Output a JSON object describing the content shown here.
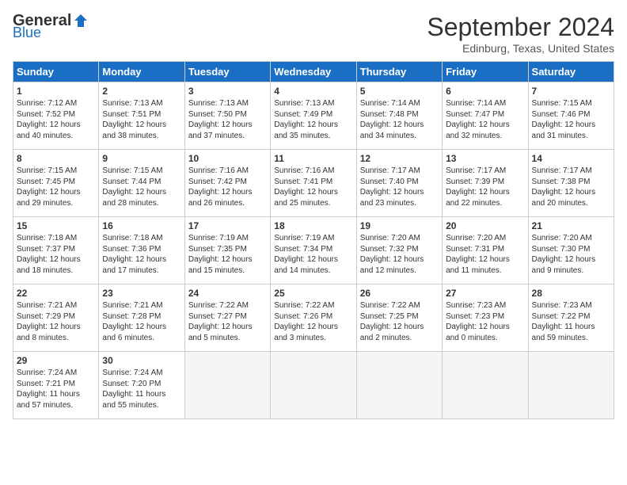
{
  "header": {
    "logo_general": "General",
    "logo_blue": "Blue",
    "month_title": "September 2024",
    "location": "Edinburg, Texas, United States"
  },
  "weekdays": [
    "Sunday",
    "Monday",
    "Tuesday",
    "Wednesday",
    "Thursday",
    "Friday",
    "Saturday"
  ],
  "weeks": [
    [
      {
        "day": "1",
        "info": "Sunrise: 7:12 AM\nSunset: 7:52 PM\nDaylight: 12 hours\nand 40 minutes."
      },
      {
        "day": "2",
        "info": "Sunrise: 7:13 AM\nSunset: 7:51 PM\nDaylight: 12 hours\nand 38 minutes."
      },
      {
        "day": "3",
        "info": "Sunrise: 7:13 AM\nSunset: 7:50 PM\nDaylight: 12 hours\nand 37 minutes."
      },
      {
        "day": "4",
        "info": "Sunrise: 7:13 AM\nSunset: 7:49 PM\nDaylight: 12 hours\nand 35 minutes."
      },
      {
        "day": "5",
        "info": "Sunrise: 7:14 AM\nSunset: 7:48 PM\nDaylight: 12 hours\nand 34 minutes."
      },
      {
        "day": "6",
        "info": "Sunrise: 7:14 AM\nSunset: 7:47 PM\nDaylight: 12 hours\nand 32 minutes."
      },
      {
        "day": "7",
        "info": "Sunrise: 7:15 AM\nSunset: 7:46 PM\nDaylight: 12 hours\nand 31 minutes."
      }
    ],
    [
      {
        "day": "8",
        "info": "Sunrise: 7:15 AM\nSunset: 7:45 PM\nDaylight: 12 hours\nand 29 minutes."
      },
      {
        "day": "9",
        "info": "Sunrise: 7:15 AM\nSunset: 7:44 PM\nDaylight: 12 hours\nand 28 minutes."
      },
      {
        "day": "10",
        "info": "Sunrise: 7:16 AM\nSunset: 7:42 PM\nDaylight: 12 hours\nand 26 minutes."
      },
      {
        "day": "11",
        "info": "Sunrise: 7:16 AM\nSunset: 7:41 PM\nDaylight: 12 hours\nand 25 minutes."
      },
      {
        "day": "12",
        "info": "Sunrise: 7:17 AM\nSunset: 7:40 PM\nDaylight: 12 hours\nand 23 minutes."
      },
      {
        "day": "13",
        "info": "Sunrise: 7:17 AM\nSunset: 7:39 PM\nDaylight: 12 hours\nand 22 minutes."
      },
      {
        "day": "14",
        "info": "Sunrise: 7:17 AM\nSunset: 7:38 PM\nDaylight: 12 hours\nand 20 minutes."
      }
    ],
    [
      {
        "day": "15",
        "info": "Sunrise: 7:18 AM\nSunset: 7:37 PM\nDaylight: 12 hours\nand 18 minutes."
      },
      {
        "day": "16",
        "info": "Sunrise: 7:18 AM\nSunset: 7:36 PM\nDaylight: 12 hours\nand 17 minutes."
      },
      {
        "day": "17",
        "info": "Sunrise: 7:19 AM\nSunset: 7:35 PM\nDaylight: 12 hours\nand 15 minutes."
      },
      {
        "day": "18",
        "info": "Sunrise: 7:19 AM\nSunset: 7:34 PM\nDaylight: 12 hours\nand 14 minutes."
      },
      {
        "day": "19",
        "info": "Sunrise: 7:20 AM\nSunset: 7:32 PM\nDaylight: 12 hours\nand 12 minutes."
      },
      {
        "day": "20",
        "info": "Sunrise: 7:20 AM\nSunset: 7:31 PM\nDaylight: 12 hours\nand 11 minutes."
      },
      {
        "day": "21",
        "info": "Sunrise: 7:20 AM\nSunset: 7:30 PM\nDaylight: 12 hours\nand 9 minutes."
      }
    ],
    [
      {
        "day": "22",
        "info": "Sunrise: 7:21 AM\nSunset: 7:29 PM\nDaylight: 12 hours\nand 8 minutes."
      },
      {
        "day": "23",
        "info": "Sunrise: 7:21 AM\nSunset: 7:28 PM\nDaylight: 12 hours\nand 6 minutes."
      },
      {
        "day": "24",
        "info": "Sunrise: 7:22 AM\nSunset: 7:27 PM\nDaylight: 12 hours\nand 5 minutes."
      },
      {
        "day": "25",
        "info": "Sunrise: 7:22 AM\nSunset: 7:26 PM\nDaylight: 12 hours\nand 3 minutes."
      },
      {
        "day": "26",
        "info": "Sunrise: 7:22 AM\nSunset: 7:25 PM\nDaylight: 12 hours\nand 2 minutes."
      },
      {
        "day": "27",
        "info": "Sunrise: 7:23 AM\nSunset: 7:23 PM\nDaylight: 12 hours\nand 0 minutes."
      },
      {
        "day": "28",
        "info": "Sunrise: 7:23 AM\nSunset: 7:22 PM\nDaylight: 11 hours\nand 59 minutes."
      }
    ],
    [
      {
        "day": "29",
        "info": "Sunrise: 7:24 AM\nSunset: 7:21 PM\nDaylight: 11 hours\nand 57 minutes."
      },
      {
        "day": "30",
        "info": "Sunrise: 7:24 AM\nSunset: 7:20 PM\nDaylight: 11 hours\nand 55 minutes."
      },
      {
        "day": "",
        "info": ""
      },
      {
        "day": "",
        "info": ""
      },
      {
        "day": "",
        "info": ""
      },
      {
        "day": "",
        "info": ""
      },
      {
        "day": "",
        "info": ""
      }
    ]
  ]
}
